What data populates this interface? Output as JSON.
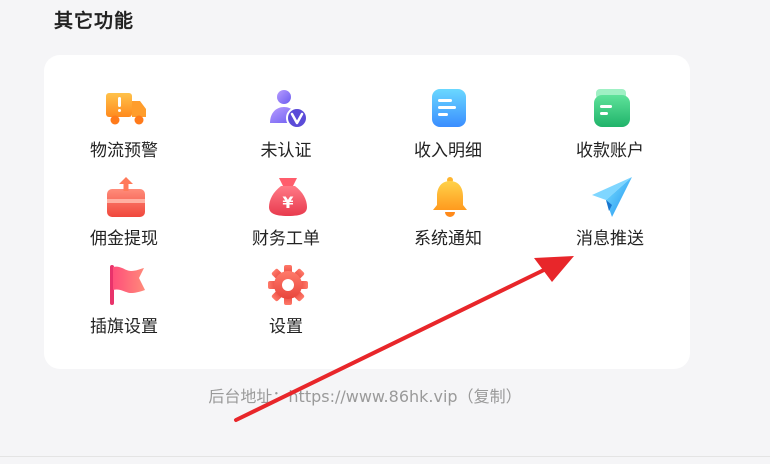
{
  "section": {
    "title": "其它功能"
  },
  "features": [
    {
      "label": "物流预警",
      "icon": "truck-warning-icon"
    },
    {
      "label": "未认证",
      "icon": "user-unverified-icon"
    },
    {
      "label": "收入明细",
      "icon": "income-detail-icon"
    },
    {
      "label": "收款账户",
      "icon": "wallet-account-icon"
    },
    {
      "label": "佣金提现",
      "icon": "commission-withdraw-icon"
    },
    {
      "label": "财务工单",
      "icon": "money-bag-icon"
    },
    {
      "label": "系统通知",
      "icon": "bell-icon"
    },
    {
      "label": "消息推送",
      "icon": "paper-plane-icon"
    },
    {
      "label": "插旗设置",
      "icon": "flag-icon"
    },
    {
      "label": "设置",
      "icon": "gear-icon"
    }
  ],
  "footer": {
    "prefix": "后台地址：https://www.86hk.vip",
    "copy_label": "（复制）"
  },
  "colors": {
    "arrow": "#e8262a",
    "title": "#222222",
    "footer_text": "#9a9a9a"
  }
}
